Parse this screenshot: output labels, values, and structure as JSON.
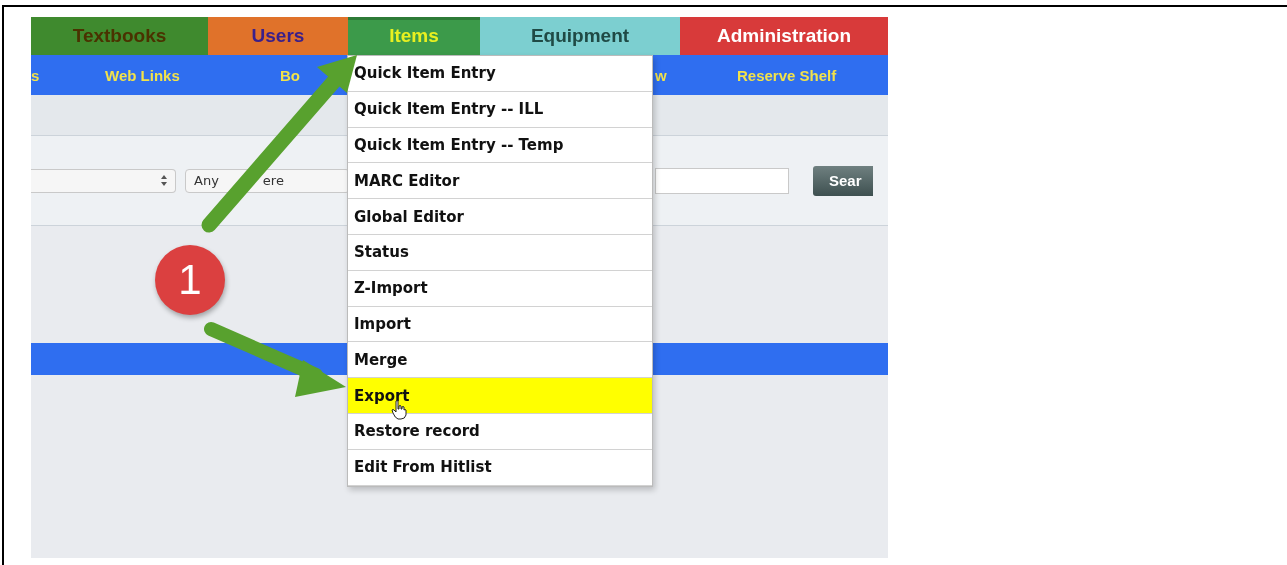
{
  "tabs": [
    {
      "label": "Textbooks",
      "color": "#3f8a2e",
      "selected": false
    },
    {
      "label": "Users",
      "color": "#e0722a",
      "selected": false
    },
    {
      "label": "Items",
      "color": "#3c9a4a",
      "selected": true
    },
    {
      "label": "Equipment",
      "color": "#7ccfd0",
      "selected": false
    },
    {
      "label": "Administration",
      "color": "#d83a3a",
      "selected": false
    }
  ],
  "subnav": [
    "s",
    "Web Links",
    "Bo",
    "w",
    "Reserve Shelf"
  ],
  "search": {
    "location": [
      "Any",
      "ere"
    ],
    "button": "Sear"
  },
  "menu": [
    {
      "label": "Quick Item Entry",
      "selected": false
    },
    {
      "label": "Quick Item Entry -- ILL",
      "selected": false
    },
    {
      "label": "Quick Item Entry -- Temp",
      "selected": false
    },
    {
      "label": "MARC Editor",
      "selected": false
    },
    {
      "label": "Global Editor",
      "selected": false
    },
    {
      "label": "Status",
      "selected": false
    },
    {
      "label": "Z-Import",
      "selected": false
    },
    {
      "label": "Import",
      "selected": false
    },
    {
      "label": "Merge",
      "selected": false
    },
    {
      "label": "Export",
      "selected": true
    },
    {
      "label": "Restore record",
      "selected": false
    },
    {
      "label": "Edit From Hitlist",
      "selected": false
    }
  ],
  "badge": "1"
}
